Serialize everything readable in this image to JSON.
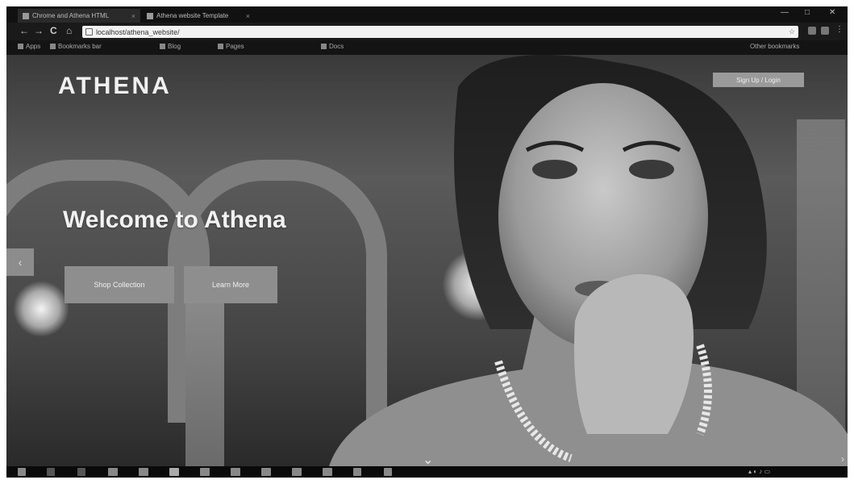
{
  "browser": {
    "tabs": [
      {
        "label": "Chrome and Athena HTML",
        "active": true
      },
      {
        "label": "Athena website Template",
        "active": false
      }
    ],
    "url": "localhost/athena_website/",
    "controls": {
      "back": "←",
      "forward": "→",
      "reload": "C",
      "home": "⌂",
      "minimize": "—",
      "maximize": "□",
      "close": "✕"
    },
    "bookmarks": [
      "Apps",
      "Bookmarks bar",
      "Blog",
      "Pages",
      "Docs"
    ],
    "other_bookmarks": "Other bookmarks"
  },
  "site": {
    "logo": "ATHENA",
    "signup_label": "Sign Up / Login",
    "welcome": "Welcome to Athena",
    "buttons": {
      "primary": "Shop Collection",
      "secondary": "Learn More"
    },
    "icons": {
      "prev": "side-arrow-icon",
      "scroll": "chevron-down-icon",
      "next": "arrow-right-icon"
    }
  },
  "taskbar": {
    "tray_time": "",
    "icons": [
      "start-icon",
      "search-icon",
      "task-view-icon",
      "explorer-icon",
      "store-icon",
      "chrome-icon",
      "mail-icon",
      "photos-icon",
      "word-icon",
      "excel-icon",
      "terminal-icon"
    ]
  },
  "colors": {
    "chrome_bg": "#1a1a1a",
    "button_gray": "#8e8e8e",
    "hero_text": "#f2f2f2"
  }
}
